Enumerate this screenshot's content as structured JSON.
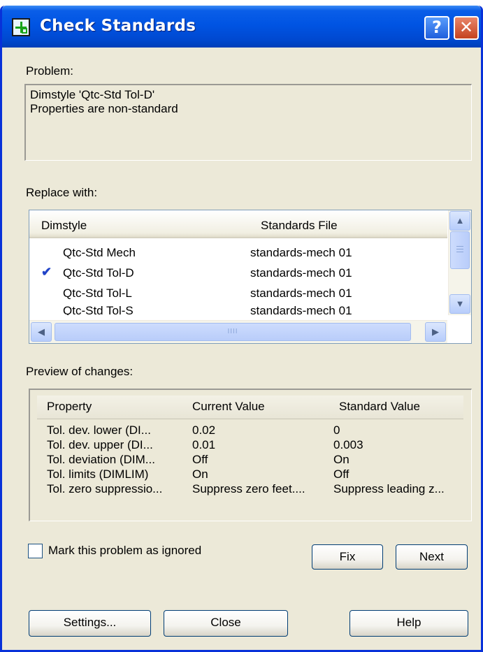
{
  "window": {
    "title": "Check Standards",
    "help_glyph": "?",
    "close_glyph": "✕"
  },
  "problem": {
    "label": "Problem:",
    "lines": [
      "Dimstyle 'Qtc-Std Tol-D'",
      "Properties are non-standard"
    ]
  },
  "replace": {
    "label": "Replace with:",
    "columns": [
      "Dimstyle",
      "Standards File"
    ],
    "selected_mark": "✔",
    "rows": [
      {
        "dimstyle": "Qtc-Std Mech",
        "file": "standards-mech 01",
        "checked": false
      },
      {
        "dimstyle": "Qtc-Std Tol-D",
        "file": "standards-mech 01",
        "checked": true
      },
      {
        "dimstyle": "Qtc-Std Tol-L",
        "file": "standards-mech 01",
        "checked": false
      },
      {
        "dimstyle": "Qtc-Std Tol-S",
        "file": "standards-mech 01",
        "checked": false
      }
    ],
    "scroll_up": "▲",
    "scroll_down": "▼",
    "scroll_left": "◀",
    "scroll_right": "▶",
    "hthumb_grip": "IIII"
  },
  "preview": {
    "label": "Preview of changes:",
    "columns": [
      "Property",
      "Current Value",
      "Standard Value"
    ],
    "rows": [
      {
        "property": "Tol. dev. lower (DI...",
        "current": "0.02",
        "standard": "0"
      },
      {
        "property": "Tol. dev. upper (DI...",
        "current": "0.01",
        "standard": "0.003"
      },
      {
        "property": "Tol. deviation (DIM...",
        "current": "Off",
        "standard": "On"
      },
      {
        "property": "Tol. limits (DIMLIM)",
        "current": "On",
        "standard": "Off"
      },
      {
        "property": "Tol. zero suppressio...",
        "current": "Suppress zero feet....",
        "standard": "Suppress leading z..."
      }
    ]
  },
  "ignore": {
    "label": "Mark this problem as ignored",
    "checked": false
  },
  "buttons": {
    "fix": "Fix",
    "next": "Next",
    "settings": "Settings...",
    "close": "Close",
    "help": "Help"
  }
}
